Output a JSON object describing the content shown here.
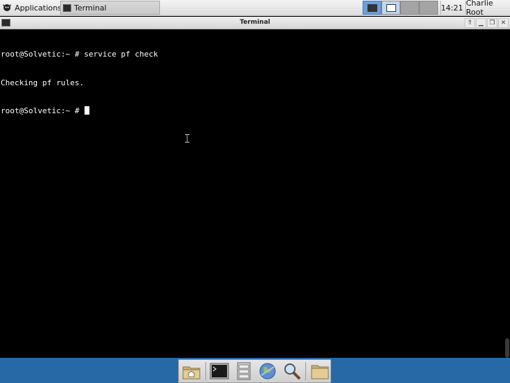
{
  "top_panel": {
    "applications_label": "Applications",
    "task_label": "Terminal",
    "clock": "14:21",
    "user": "Charlie Root"
  },
  "window": {
    "title": "Terminal"
  },
  "terminal": {
    "lines": [
      "root@Solvetic:~ # service pf check",
      "Checking pf rules.",
      "root@Solvetic:~ # "
    ]
  },
  "dock": {
    "items": [
      "home-folder",
      "terminal",
      "file-cabinet",
      "web-browser",
      "search",
      "folder"
    ]
  },
  "colors": {
    "terminal_bg": "#000000",
    "terminal_fg": "#ffffff",
    "bottom_bar": "#2769a6",
    "active_workspace": "#6e9fd7"
  }
}
